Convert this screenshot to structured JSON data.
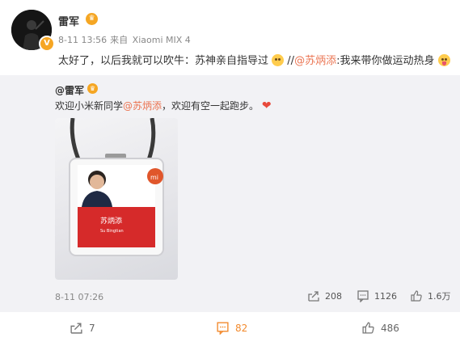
{
  "post": {
    "author": "雷军",
    "time": "8-11 13:56",
    "source_prefix": "来自",
    "device": "Xiaomi MIX 4",
    "text_part1": "太好了，以后我就可以吹牛：苏神亲自指导过",
    "text_sep": " //",
    "mention": "@苏炳添",
    "text_part2": ":我来带你做运动热身"
  },
  "repost": {
    "author": "@雷军",
    "text_part1": "欢迎小米新同学",
    "mention": "@苏炳添",
    "text_part2": "，欢迎有空一起跑步。",
    "card_name": "苏炳添",
    "card_name_en": "Su Bingtian",
    "card_logo": "mi",
    "time": "8-11 07:26",
    "reposts": "208",
    "comments": "1126",
    "likes": "1.6万"
  },
  "actions": {
    "repost_count": "7",
    "comment_count": "82",
    "like_count": "486"
  },
  "colors": {
    "accent": "#eb7350",
    "repost_bg": "#f2f2f5",
    "badge_red": "#d62a2a"
  },
  "icons": [
    "avatar-photo",
    "verified-badge-icon",
    "vip-icon",
    "laugh-emoji-icon",
    "tongue-emoji-icon",
    "heart-icon",
    "repost-icon",
    "comment-icon",
    "like-icon"
  ]
}
